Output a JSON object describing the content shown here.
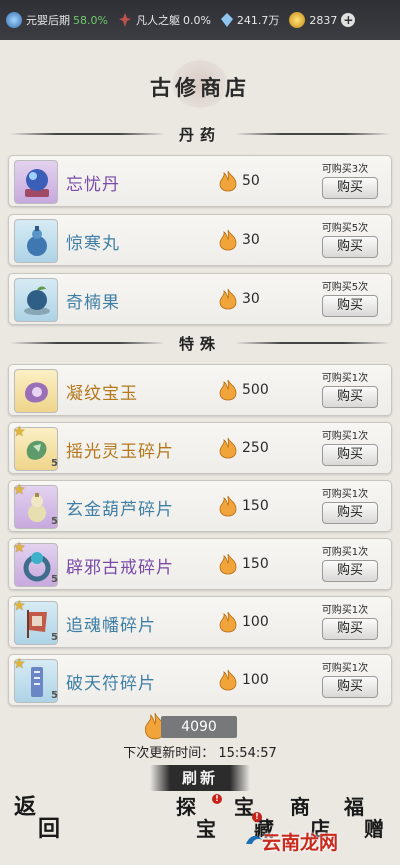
{
  "topbar": {
    "realm_label": "元婴后期",
    "realm_percent": "58.0%",
    "body_label": "凡人之躯",
    "body_percent": "0.0%",
    "gems": "241.7万",
    "coins": "2837",
    "plus": "+"
  },
  "shop": {
    "title": "古修商店"
  },
  "sections": [
    {
      "title": "丹药",
      "items": [
        {
          "name": "忘忧丹",
          "price": "50",
          "limit": "可购买3次",
          "buy": "购买"
        },
        {
          "name": "惊寒丸",
          "price": "30",
          "limit": "可购买5次",
          "buy": "购买"
        },
        {
          "name": "奇楠果",
          "price": "30",
          "limit": "可购买5次",
          "buy": "购买"
        }
      ]
    },
    {
      "title": "特殊",
      "items": [
        {
          "name": "凝纹宝玉",
          "price": "500",
          "limit": "可购买1次",
          "buy": "购买"
        },
        {
          "name": "摇光灵玉碎片",
          "price": "250",
          "limit": "可购买1次",
          "buy": "购买",
          "count": "5"
        },
        {
          "name": "玄金葫芦碎片",
          "price": "150",
          "limit": "可购买1次",
          "buy": "购买",
          "count": "5"
        },
        {
          "name": "辟邪古戒碎片",
          "price": "150",
          "limit": "可购买1次",
          "buy": "购买",
          "count": "5"
        },
        {
          "name": "追魂幡碎片",
          "price": "100",
          "limit": "可购买1次",
          "buy": "购买",
          "count": "5"
        },
        {
          "name": "破天符碎片",
          "price": "100",
          "limit": "可购买1次",
          "buy": "购买",
          "count": "5"
        }
      ]
    }
  ],
  "footer": {
    "balance": "4090",
    "next_refresh_label": "下次更新时间：",
    "next_refresh_time": "15:54:57",
    "refresh": "刷新"
  },
  "bottom_nav": {
    "back": [
      "返",
      "回"
    ],
    "explore": [
      "探",
      "宝"
    ],
    "treasure": [
      "宝",
      "藏"
    ],
    "store": [
      "商",
      "店"
    ],
    "welfare": [
      "福",
      "赠"
    ],
    "badge": "!"
  },
  "watermark": "云南龙网",
  "colors": {
    "purple": "#7a4aa8",
    "blue": "#3f7fa6",
    "gold": "#b4781b",
    "badge_red": "#c8231b"
  }
}
